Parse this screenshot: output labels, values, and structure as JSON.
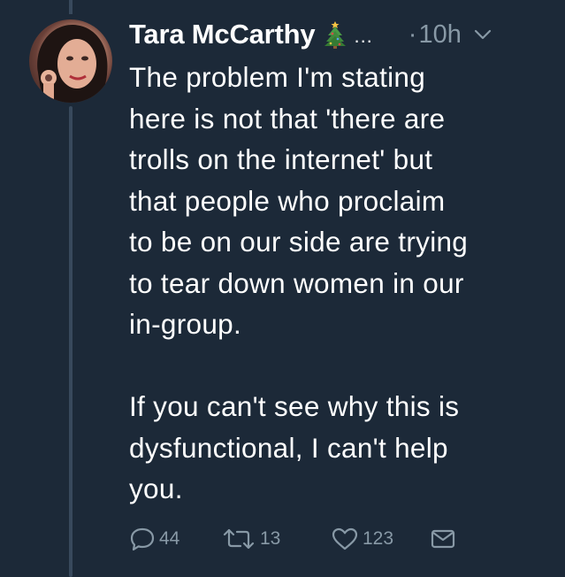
{
  "tweet": {
    "display_name": "Tara McCarthy",
    "emoji": "christmas-tree-icon",
    "truncated": "...",
    "dot": "·",
    "time": "10h",
    "body": "The problem I'm stating\nhere is not that 'there are\ntrolls on the internet' but\nthat people who proclaim\nto be on our side are trying\nto tear down women in our\nin-group.\n\nIf you can't see why this is\ndysfunctional, I can't help\nyou."
  },
  "actions": {
    "reply_count": "44",
    "retweet_count": "13",
    "like_count": "123"
  },
  "colors": {
    "background": "#1c2938",
    "text": "#ffffff",
    "muted": "#8899a6",
    "thread_line": "#38495c"
  }
}
